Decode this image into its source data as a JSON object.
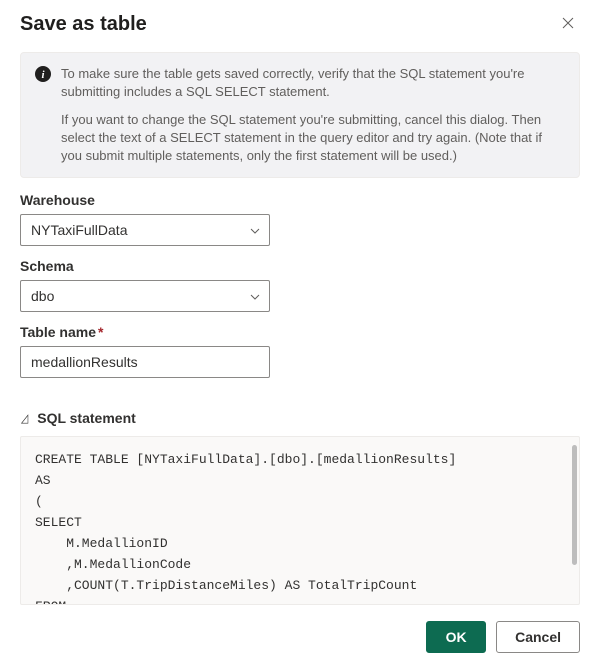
{
  "header": {
    "title": "Save as table"
  },
  "info": {
    "para1": "To make sure the table gets saved correctly, verify that the SQL statement you're submitting includes a SQL SELECT statement.",
    "para2": "If you want to change the SQL statement you're submitting, cancel this dialog. Then select the text of a SELECT statement in the query editor and try again. (Note that if you submit multiple statements, only the first statement will be used.)"
  },
  "fields": {
    "warehouse": {
      "label": "Warehouse",
      "value": "NYTaxiFullData"
    },
    "schema": {
      "label": "Schema",
      "value": "dbo"
    },
    "tableName": {
      "label": "Table name",
      "value": "medallionResults"
    }
  },
  "sqlSection": {
    "label": "SQL statement",
    "code": "CREATE TABLE [NYTaxiFullData].[dbo].[medallionResults]\nAS\n(\nSELECT\n    M.MedallionID\n    ,M.MedallionCode\n    ,COUNT(T.TripDistanceMiles) AS TotalTripCount\nFROM\n    dbo.Trip AS T\nJOIN"
  },
  "footer": {
    "ok": "OK",
    "cancel": "Cancel"
  }
}
